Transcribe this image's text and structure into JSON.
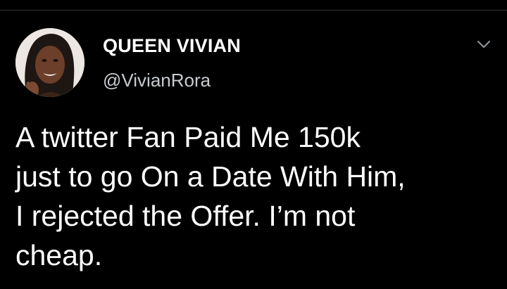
{
  "author": {
    "display_name": "QUEEN VIVIAN",
    "handle": "@VivianRora",
    "avatar_icon": "profile-photo"
  },
  "tweet": {
    "lines": [
      "A twitter Fan Paid Me 150k",
      "just to go On a Date With Him,",
      "I rejected the Offer. I’m not",
      "cheap."
    ]
  },
  "menu": {
    "icon": "chevron-down-icon"
  },
  "colors": {
    "background": "#000000",
    "text": "#ffffff",
    "secondary_text": "#c7cbd0",
    "divider": "#2f3336"
  }
}
